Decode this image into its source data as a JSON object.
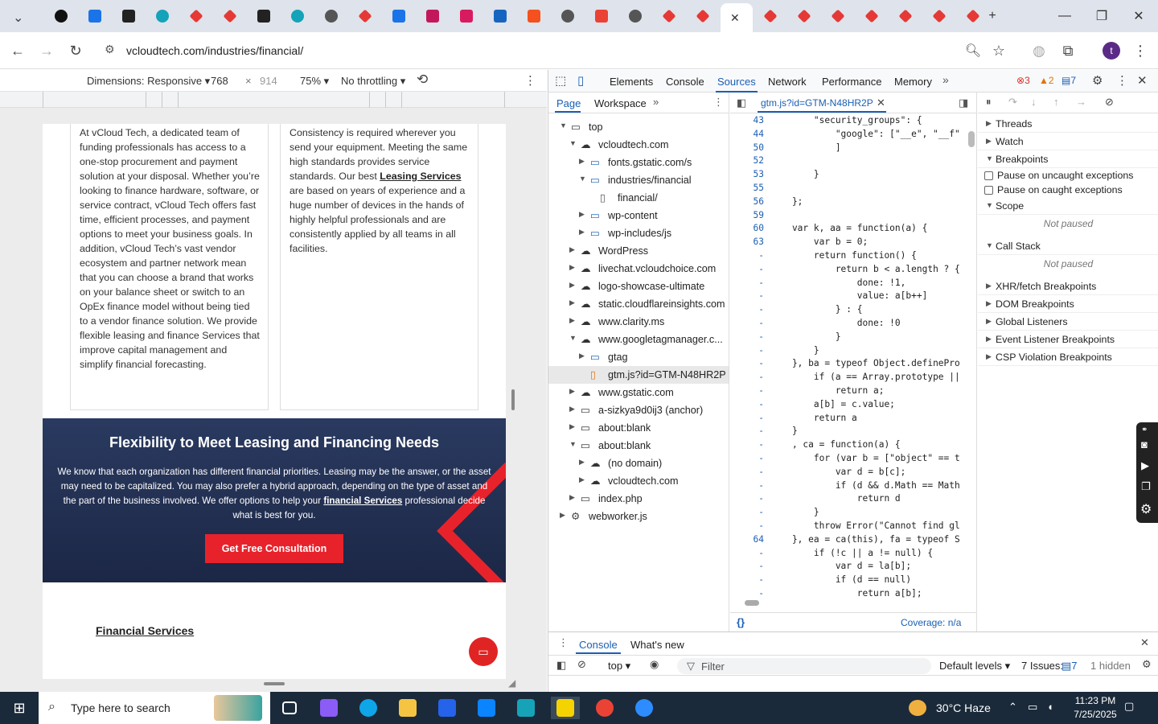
{
  "tabs": [
    {
      "icon": "chevron-down-icon",
      "color": "#3c4043"
    },
    {
      "icon": "circle-logo-icon",
      "color": "#111111"
    },
    {
      "icon": "gauge-icon",
      "color": "#1a73e8"
    },
    {
      "icon": "aperture-icon",
      "color": "#222222"
    },
    {
      "icon": "teal-app-icon",
      "color": "#14a3b8"
    },
    {
      "icon": "red-diamond-icon",
      "color": "#e53935"
    },
    {
      "icon": "red-diamond-icon",
      "color": "#e53935"
    },
    {
      "icon": "v-logo-icon",
      "color": "#222222"
    },
    {
      "icon": "teal-app-icon",
      "color": "#14a3b8"
    },
    {
      "icon": "globe-icon",
      "color": "#555555"
    },
    {
      "icon": "red-diamond-icon",
      "color": "#e53935"
    },
    {
      "icon": "scales-icon",
      "color": "#1a73e8"
    },
    {
      "icon": "swirl-icon",
      "color": "#c2185b"
    },
    {
      "icon": "lightning-icon",
      "color": "#d81b60"
    },
    {
      "icon": "wave-icon",
      "color": "#1565c0"
    },
    {
      "icon": "slash-icon",
      "color": "#f4511e"
    },
    {
      "icon": "globe-icon",
      "color": "#555555"
    },
    {
      "icon": "gmail-icon",
      "color": "#ea4335"
    },
    {
      "icon": "globe-icon",
      "color": "#555555"
    },
    {
      "icon": "red-diamond-icon",
      "color": "#e53935"
    },
    {
      "icon": "red-diamond-icon",
      "color": "#e53935"
    },
    {
      "icon": "close-icon",
      "color": "#333333",
      "active": true
    },
    {
      "icon": "red-diamond-icon",
      "color": "#e53935"
    },
    {
      "icon": "red-diamond-icon",
      "color": "#e53935"
    },
    {
      "icon": "red-diamond-icon",
      "color": "#e53935"
    },
    {
      "icon": "red-diamond-icon",
      "color": "#e53935"
    },
    {
      "icon": "red-diamond-icon",
      "color": "#e53935"
    },
    {
      "icon": "red-diamond-icon",
      "color": "#e53935"
    },
    {
      "icon": "red-diamond-icon",
      "color": "#e53935"
    }
  ],
  "window": {
    "new_tab": "+",
    "minimize": "—",
    "restore": "❐",
    "close": "✕"
  },
  "omnibox": {
    "url": "vcloudtech.com/industries/financial/"
  },
  "profile": {
    "initial": "t",
    "color": "#5b2a86"
  },
  "device_bar": {
    "dimensions_label": "Dimensions: Responsive ▾",
    "width": "768",
    "times": "×",
    "height": "914",
    "zoom": "75% ▾",
    "throttling": "No throttling ▾"
  },
  "page": {
    "card_left": "At vCloud Tech, a dedicated team of funding professionals has access to a one-stop procurement and payment solution at your disposal. Whether you’re looking to finance hardware, software, or service contract, vCloud Tech offers fast time, efficient processes, and payment options to meet your business goals. In addition, vCloud Tech’s vast vendor ecosystem and partner network mean that you can choose a brand that works on your balance sheet or switch to an OpEx finance model without being tied to a vendor finance solution. We provide flexible leasing and finance Services that improve capital management and simplify financial forecasting.",
    "card_right_a": "Consistency is required wherever you send your equipment. Meeting the same high standards provides service standards. Our best ",
    "card_right_link": "Leasing Services",
    "card_right_b": " are based on years of experience and a huge number of devices in the hands of highly helpful professionals and are consistently applied by all teams in all facilities.",
    "banner_title": "Flexibility to Meet Leasing and Financing Needs",
    "banner_text_a": "We know that each organization has different financial priorities. Leasing may be the answer, or the asset may need to be capitalized. You may also prefer a hybrid approach, depending on the type of asset and the part of the business involved. We offer options to help your ",
    "banner_link": "financial Services",
    "banner_text_b": " professional decide what is best for you.",
    "cta": "Get Free Consultation",
    "fin_link": "Financial Services",
    "accent": "#e8222b"
  },
  "devtools": {
    "tabs": [
      "Elements",
      "Console",
      "Sources",
      "Network",
      "Performance",
      "Memory"
    ],
    "selected_tab": "Sources",
    "errors": "3",
    "warnings": "2",
    "messages": "7",
    "nav_tabs": [
      "Page",
      "Workspace"
    ],
    "tree": [
      {
        "d": 0,
        "arr": "▼",
        "ic": "frame",
        "label": "top"
      },
      {
        "d": 1,
        "arr": "▼",
        "ic": "cloud",
        "label": "vcloudtech.com"
      },
      {
        "d": 2,
        "arr": "▶",
        "ic": "folder",
        "label": "fonts.gstatic.com/s"
      },
      {
        "d": 2,
        "arr": "▼",
        "ic": "folder",
        "label": "industries/financial"
      },
      {
        "d": 3,
        "arr": "",
        "ic": "file",
        "label": "financial/"
      },
      {
        "d": 2,
        "arr": "▶",
        "ic": "folder",
        "label": "wp-content"
      },
      {
        "d": 2,
        "arr": "▶",
        "ic": "folder",
        "label": "wp-includes/js"
      },
      {
        "d": 1,
        "arr": "▶",
        "ic": "cloud",
        "label": "WordPress"
      },
      {
        "d": 1,
        "arr": "▶",
        "ic": "cloud",
        "label": "livechat.vcloudchoice.com"
      },
      {
        "d": 1,
        "arr": "▶",
        "ic": "cloud",
        "label": "logo-showcase-ultimate"
      },
      {
        "d": 1,
        "arr": "▶",
        "ic": "cloud",
        "label": "static.cloudflareinsights.com"
      },
      {
        "d": 1,
        "arr": "▶",
        "ic": "cloud",
        "label": "www.clarity.ms"
      },
      {
        "d": 1,
        "arr": "▼",
        "ic": "cloud",
        "label": "www.googletagmanager.c..."
      },
      {
        "d": 2,
        "arr": "▶",
        "ic": "folder",
        "label": "gtag"
      },
      {
        "d": 2,
        "arr": "",
        "ic": "jsfile",
        "label": "gtm.js?id=GTM-N48HR2P",
        "sel": true
      },
      {
        "d": 1,
        "arr": "▶",
        "ic": "cloud",
        "label": "www.gstatic.com"
      },
      {
        "d": 1,
        "arr": "▶",
        "ic": "frame",
        "label": "a-sizkya9d0ij3 (anchor)"
      },
      {
        "d": 1,
        "arr": "▶",
        "ic": "frame",
        "label": "about:blank"
      },
      {
        "d": 1,
        "arr": "▼",
        "ic": "frame",
        "label": "about:blank"
      },
      {
        "d": 2,
        "arr": "▶",
        "ic": "cloud",
        "label": "(no domain)"
      },
      {
        "d": 2,
        "arr": "▶",
        "ic": "cloud",
        "label": "vcloudtech.com"
      },
      {
        "d": 1,
        "arr": "▶",
        "ic": "frame",
        "label": "index.php"
      },
      {
        "d": 0,
        "arr": "▶",
        "ic": "gear",
        "label": "webworker.js"
      }
    ],
    "editor_tab": "gtm.js?id=GTM-N48HR2P",
    "code": [
      {
        "ln": "43",
        "t": "        \"security_groups\": {"
      },
      {
        "ln": "44",
        "t": "            \"google\": [\"__e\", \"__f\""
      },
      {
        "ln": "50",
        "t": "            ]"
      },
      {
        "ln": "52",
        "t": ""
      },
      {
        "ln": "53",
        "t": "        }"
      },
      {
        "ln": "55",
        "t": ""
      },
      {
        "ln": "56",
        "t": "    };"
      },
      {
        "ln": "59",
        "t": ""
      },
      {
        "ln": "60",
        "t": "    var k, aa = function(a) {"
      },
      {
        "ln": "63",
        "t": "        var b = 0;"
      },
      {
        "ln": "-",
        "t": "        return function() {"
      },
      {
        "ln": "-",
        "t": "            return b < a.length ? {"
      },
      {
        "ln": "-",
        "t": "                done: !1,"
      },
      {
        "ln": "-",
        "t": "                value: a[b++]"
      },
      {
        "ln": "-",
        "t": "            } : {"
      },
      {
        "ln": "-",
        "t": "                done: !0"
      },
      {
        "ln": "-",
        "t": "            }"
      },
      {
        "ln": "-",
        "t": "        }"
      },
      {
        "ln": "-",
        "t": "    }, ba = typeof Object.definePro"
      },
      {
        "ln": "-",
        "t": "        if (a == Array.prototype ||"
      },
      {
        "ln": "-",
        "t": "            return a;"
      },
      {
        "ln": "-",
        "t": "        a[b] = c.value;"
      },
      {
        "ln": "-",
        "t": "        return a"
      },
      {
        "ln": "-",
        "t": "    }"
      },
      {
        "ln": "-",
        "t": "    , ca = function(a) {"
      },
      {
        "ln": "-",
        "t": "        for (var b = [\"object\" == t"
      },
      {
        "ln": "-",
        "t": "            var d = b[c];"
      },
      {
        "ln": "-",
        "t": "            if (d && d.Math == Math"
      },
      {
        "ln": "-",
        "t": "                return d"
      },
      {
        "ln": "-",
        "t": "        }"
      },
      {
        "ln": "-",
        "t": "        throw Error(\"Cannot find gl"
      },
      {
        "ln": "64",
        "t": "    }, ea = ca(this), fa = typeof S"
      },
      {
        "ln": "-",
        "t": "        if (!c || a != null) {"
      },
      {
        "ln": "-",
        "t": "            var d = la[b];"
      },
      {
        "ln": "-",
        "t": "            if (d == null)"
      },
      {
        "ln": "-",
        "t": "                return a[b];"
      }
    ],
    "coverage": "Coverage: n/a",
    "format_icon": "{}",
    "debugger": [
      {
        "type": "section",
        "arr": "▶",
        "label": "Threads"
      },
      {
        "type": "section",
        "arr": "▶",
        "label": "Watch"
      },
      {
        "type": "section",
        "arr": "▼",
        "label": "Breakpoints"
      },
      {
        "type": "check",
        "label": "Pause on uncaught exceptions"
      },
      {
        "type": "check",
        "label": "Pause on caught exceptions"
      },
      {
        "type": "section",
        "arr": "▼",
        "label": "Scope"
      },
      {
        "type": "note",
        "label": "Not paused"
      },
      {
        "type": "section",
        "arr": "▼",
        "label": "Call Stack"
      },
      {
        "type": "note",
        "label": "Not paused"
      },
      {
        "type": "section",
        "arr": "▶",
        "label": "XHR/fetch Breakpoints"
      },
      {
        "type": "section",
        "arr": "▶",
        "label": "DOM Breakpoints"
      },
      {
        "type": "section",
        "arr": "▶",
        "label": "Global Listeners"
      },
      {
        "type": "section",
        "arr": "▶",
        "label": "Event Listener Breakpoints"
      },
      {
        "type": "section",
        "arr": "▶",
        "label": "CSP Violation Breakpoints"
      }
    ],
    "drawer_tabs": [
      "Console",
      "What's new"
    ],
    "console_context": "top ▾",
    "filter_placeholder": "Filter",
    "default_levels": "Default levels ▾",
    "issues": "7 Issues:",
    "issues_count": "7",
    "hidden": "1 hidden"
  },
  "taskbar": {
    "search": "Type here to search",
    "weather": "30°C  Haze",
    "time": "11:23 PM",
    "date": "7/25/2025",
    "apps": [
      {
        "icon": "task-view-icon",
        "color": "#ffffff"
      },
      {
        "icon": "copilot-icon",
        "color": "#8b5cf6"
      },
      {
        "icon": "edge-icon",
        "color": "#0ea5e9"
      },
      {
        "icon": "file-explorer-icon",
        "color": "#f5c542"
      },
      {
        "icon": "store-icon",
        "color": "#2563eb"
      },
      {
        "icon": "mail-icon",
        "color": "#0a84ff"
      },
      {
        "icon": "app-icon",
        "color": "#16a3b8"
      },
      {
        "icon": "sticky-notes-icon",
        "color": "#f5d300"
      },
      {
        "icon": "chrome-icon",
        "color": "#ea4335"
      },
      {
        "icon": "zoom-icon",
        "color": "#2d8cff"
      }
    ]
  }
}
